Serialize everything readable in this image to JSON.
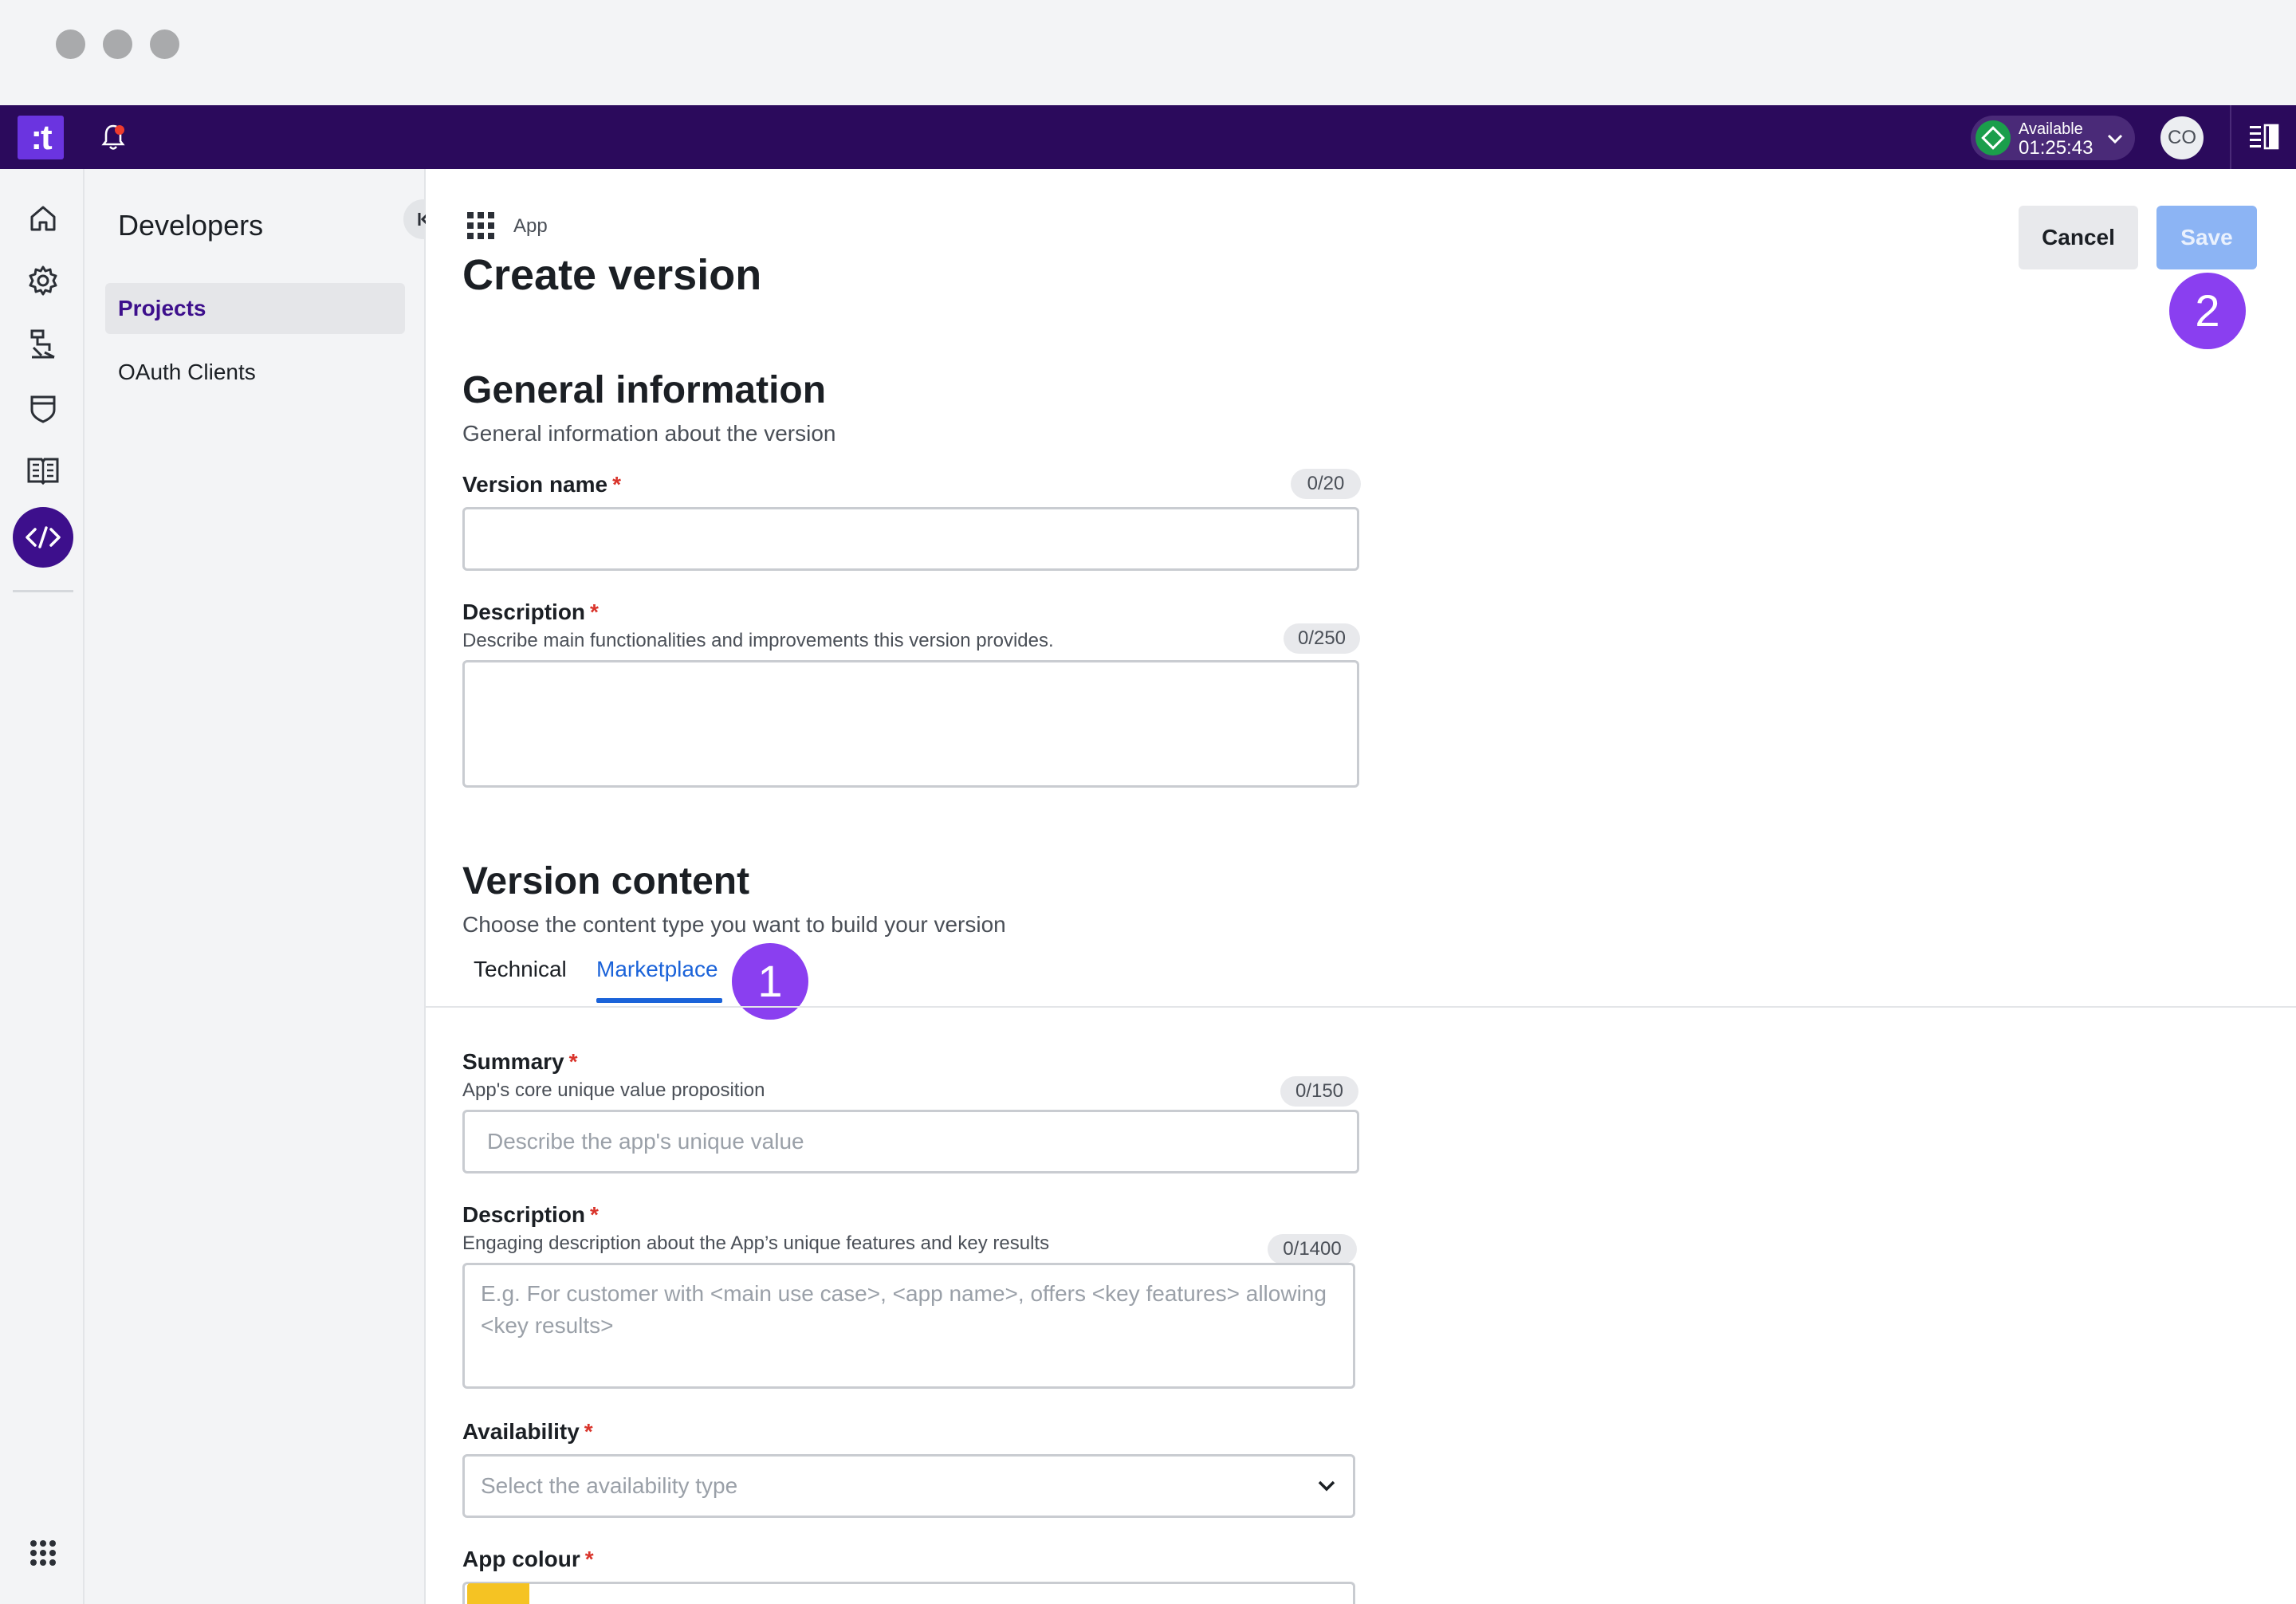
{
  "app": {
    "logo_text": ":t",
    "status": {
      "label": "Available",
      "timer": "01:25:43"
    },
    "user_initials": "CO",
    "colors": {
      "topbar": "#2b0a5c",
      "accent": "#3d0f8c",
      "link": "#1b63d9",
      "status_green": "#1b9e4b",
      "save_disabled": "#8cb4f4",
      "required": "#d9342b",
      "app_colour": "#f5c323"
    }
  },
  "rail": {
    "icons": [
      "home-icon",
      "gear-icon",
      "workflow-icon",
      "shield-icon",
      "book-icon",
      "code-icon",
      "apps-grid-icon"
    ],
    "active": "code-icon"
  },
  "subnav": {
    "title": "Developers",
    "items": [
      {
        "label": "Projects",
        "active": true
      },
      {
        "label": "OAuth Clients",
        "active": false
      }
    ]
  },
  "header": {
    "breadcrumb": "App",
    "title": "Create version",
    "cancel_label": "Cancel",
    "save_label": "Save"
  },
  "steps": {
    "marketplace_tab": "1",
    "save_button": "2"
  },
  "general": {
    "title": "General information",
    "subtitle": "General information about the version",
    "version_name": {
      "label": "Version name",
      "counter": "0/20",
      "value": ""
    },
    "description": {
      "label": "Description",
      "help": "Describe main functionalities and improvements this version provides.",
      "counter": "0/250",
      "value": ""
    }
  },
  "content": {
    "title": "Version content",
    "subtitle": "Choose the content type you want to build your version",
    "tabs": [
      {
        "label": "Technical",
        "active": false
      },
      {
        "label": "Marketplace",
        "active": true
      }
    ],
    "summary": {
      "label": "Summary",
      "help": "App's core unique value proposition",
      "counter": "0/150",
      "placeholder": "Describe the app's unique value"
    },
    "description": {
      "label": "Description",
      "help": "Engaging description about the App’s unique features and key results",
      "counter": "0/1400",
      "placeholder": "E.g. For customer with <main use case>, <app name>, offers <key features> allowing <key results>"
    },
    "availability": {
      "label": "Availability",
      "placeholder": "Select the availability type"
    },
    "app_colour": {
      "label": "App colour"
    }
  },
  "required_mark": "*"
}
